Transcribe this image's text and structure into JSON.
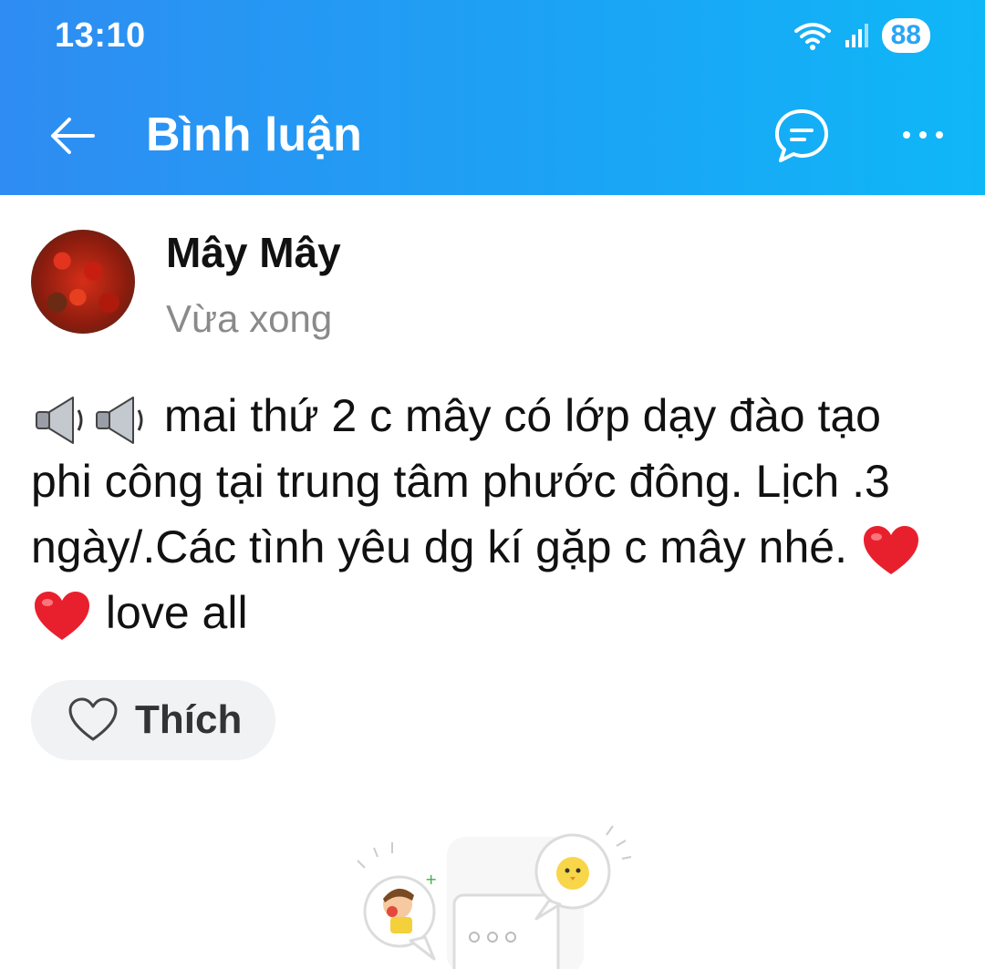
{
  "status_bar": {
    "time": "13:10",
    "battery": "88"
  },
  "header": {
    "title": "Bình luận",
    "back_icon": "back-arrow-icon",
    "chat_icon": "chat-bubble-icon",
    "more_icon": "more-dots-icon"
  },
  "post": {
    "author": "Mây Mây",
    "time": "Vừa xong",
    "text": "mai thứ 2 c mây có lớp dạy đào tạo phi công tại trung tâm phước đông. Lịch .3 ngày/.Các tình yêu dg kí gặp c mây nhé.",
    "text_end": "love all",
    "leading_icons": [
      "speaker-icon",
      "speaker-icon"
    ],
    "trailing_icons": [
      "red-heart-icon",
      "red-heart-icon"
    ]
  },
  "actions": {
    "like_label": "Thích",
    "like_icon": "heart-outline-icon"
  },
  "colors": {
    "header_start": "#2f8cf2",
    "header_end": "#0fb7f7",
    "heart": "#e8202e"
  }
}
